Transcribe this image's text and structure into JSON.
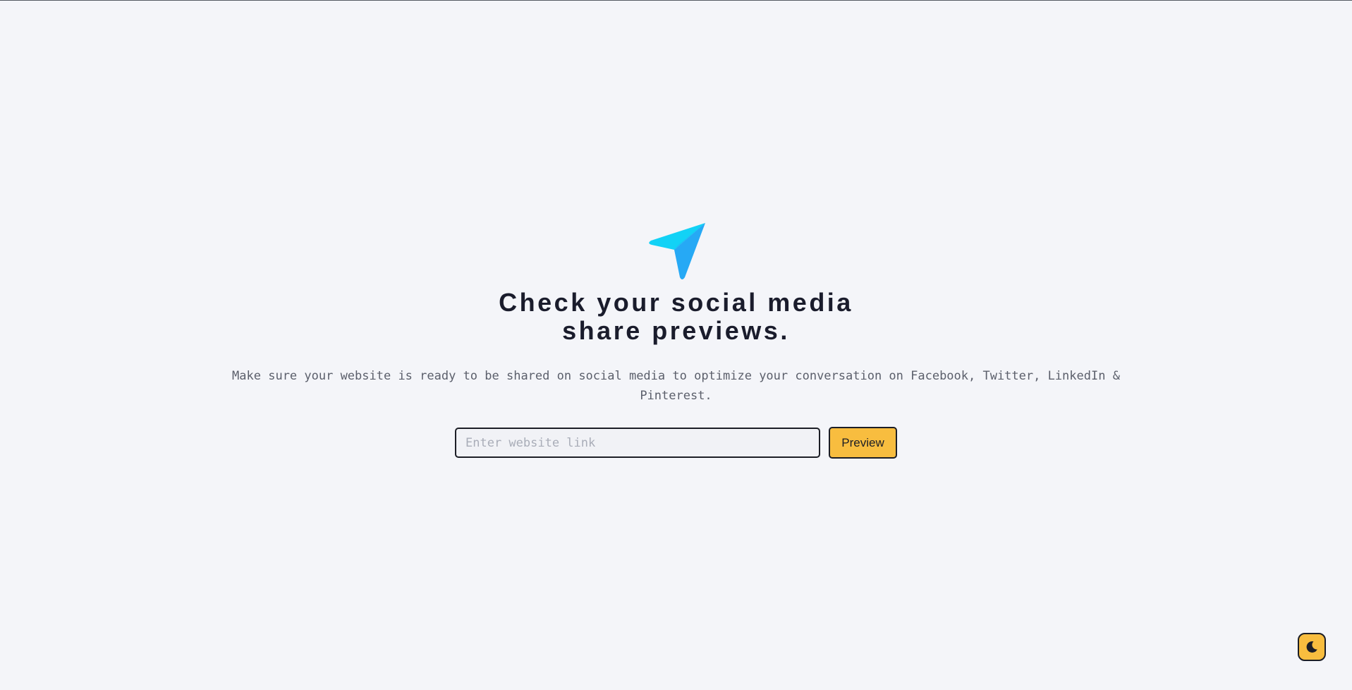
{
  "hero": {
    "logo_icon": "paper-plane-icon",
    "headline_line1": "Check your social media",
    "headline_line2": "share previews.",
    "subtitle": "Make sure your website is ready to be shared on social media to optimize your conversation on Facebook, Twitter, LinkedIn & Pinterest."
  },
  "form": {
    "input_placeholder": "Enter website link",
    "input_value": "",
    "preview_label": "Preview"
  },
  "theme_toggle": {
    "icon": "moon-icon"
  },
  "colors": {
    "background": "#f4f5f9",
    "accent": "#f8bd3f",
    "logo_light": "#12d2f6",
    "logo_dark": "#26a9f5",
    "text_dark": "#1a1c2c",
    "text_muted": "#5b5f6b"
  }
}
